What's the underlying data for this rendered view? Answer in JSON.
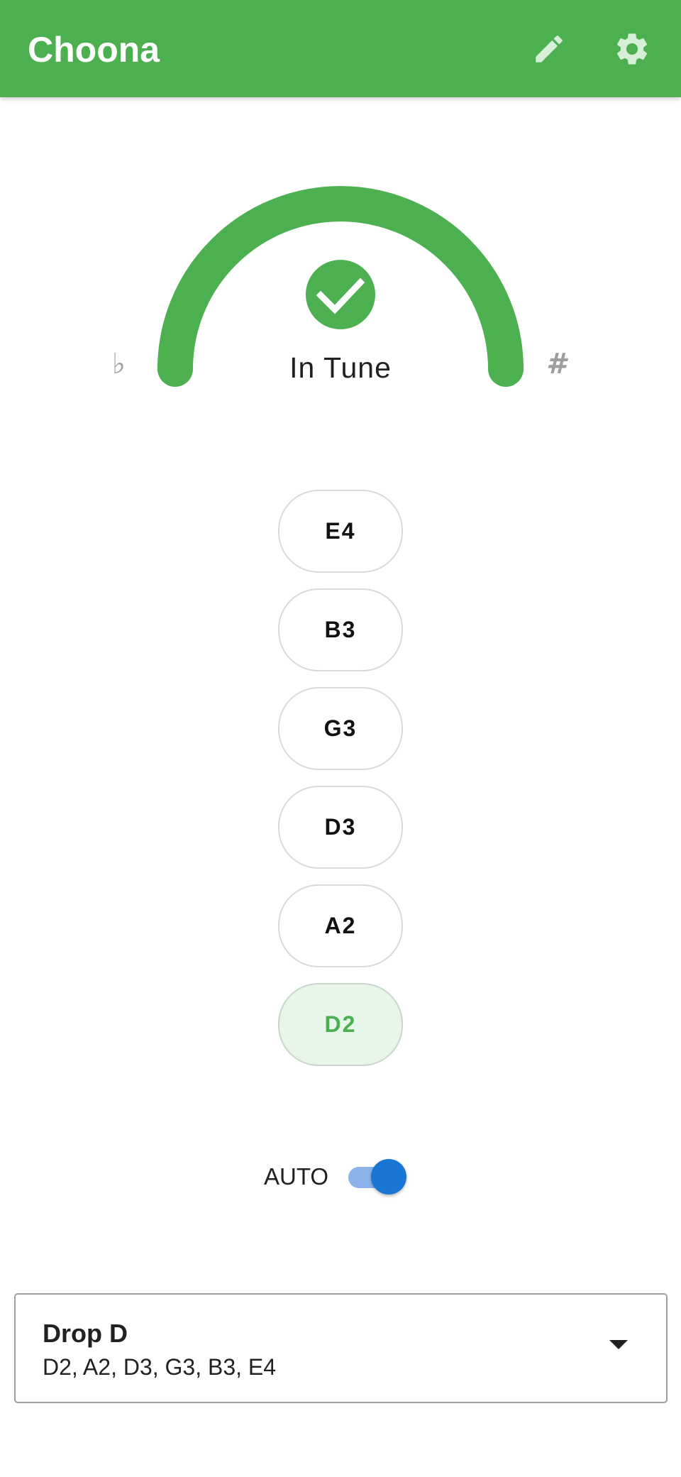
{
  "app_bar": {
    "title": "Choona",
    "actions": [
      {
        "icon": "pencil-icon",
        "label": "Edit tuning"
      },
      {
        "icon": "gear-icon",
        "label": "Settings"
      }
    ],
    "background_color": "#4caf50"
  },
  "tuner": {
    "status": "In Tune",
    "status_icon": "check-circle-icon",
    "flat_symbol": "♭",
    "sharp_symbol": "#",
    "in_tune_color": "#4caf50"
  },
  "strings": {
    "items": [
      {
        "note": "E4",
        "selected": false
      },
      {
        "note": "B3",
        "selected": false
      },
      {
        "note": "G3",
        "selected": false
      },
      {
        "note": "D3",
        "selected": false
      },
      {
        "note": "A2",
        "selected": false
      },
      {
        "note": "D2",
        "selected": true
      }
    ]
  },
  "auto_mode": {
    "label": "AUTO",
    "enabled": true,
    "accent_color": "#1976d2"
  },
  "tuning_selector": {
    "name": "Drop D",
    "notes": "D2, A2, D3, G3, B3, E4",
    "icon": "caret-down-icon"
  }
}
